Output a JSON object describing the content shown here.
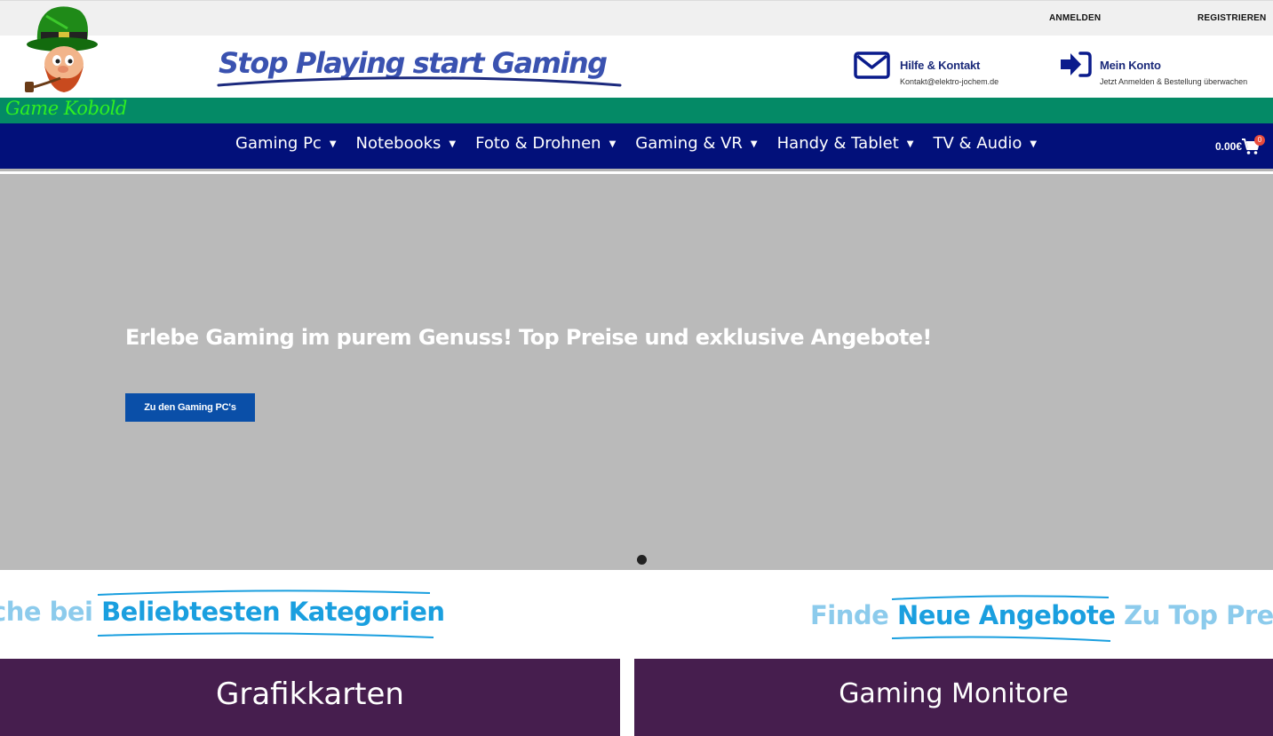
{
  "topbar": {
    "login": "ANMELDEN",
    "register": "REGISTRIEREN"
  },
  "logo": {
    "text": "Game Kobold",
    "icon": "leprechaun-mascot-icon"
  },
  "header": {
    "slogan": "Stop Playing start Gaming",
    "contact": {
      "title": "Hilfe & Kontakt",
      "email": "Kontakt@elektro-jochem.de",
      "icon": "mail-icon"
    },
    "account": {
      "title": "Mein Konto",
      "subtitle": "Jetzt Anmelden & Bestellung überwachen",
      "icon": "sign-in-icon"
    }
  },
  "nav": {
    "items": [
      {
        "label": "Gaming Pc"
      },
      {
        "label": "Notebooks"
      },
      {
        "label": "Foto & Drohnen"
      },
      {
        "label": "Gaming & VR"
      },
      {
        "label": "Handy & Tablet"
      },
      {
        "label": "TV & Audio"
      }
    ],
    "cart_total": "0.00€",
    "cart_count": "0"
  },
  "hero": {
    "title": "Erlebe Gaming im purem Genuss! Top Preise und exklusive Angebote!",
    "button": "Zu den Gaming PC's"
  },
  "sections": {
    "left": {
      "prefix": "che bei",
      "highlight": "Beliebtesten Kategorien"
    },
    "right": {
      "prefix": "Finde",
      "highlight": "Neue Angebote",
      "suffix": "Zu Top Preis"
    }
  },
  "tiles": {
    "left": "Grafikkarten",
    "right": "Gaming Monitore"
  },
  "colors": {
    "nav": "#02107a",
    "green": "#048a66",
    "accent": "#1a9fdf",
    "tile": "#461e4e",
    "button": "#0a4fa8"
  }
}
